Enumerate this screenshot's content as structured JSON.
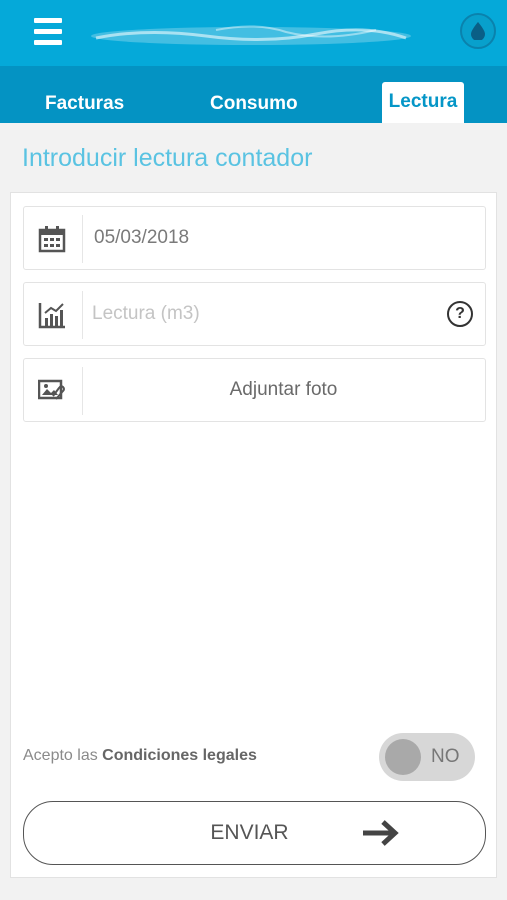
{
  "header": {
    "menu_icon": "hamburger-icon",
    "logo": "brand-logo",
    "drop_icon": "water-drop-icon"
  },
  "tabs": [
    {
      "label": "Facturas"
    },
    {
      "label": "Consumo"
    },
    {
      "label": "Lectura",
      "active": true
    }
  ],
  "page": {
    "title": "Introducir lectura contador"
  },
  "form": {
    "date_value": "05/03/2018",
    "reading_placeholder": "Lectura (m3)",
    "photo_label": "Adjuntar foto",
    "help_symbol": "?"
  },
  "legal": {
    "prefix": "Acepto las ",
    "link": "Condiciones legales",
    "toggle_label": "NO"
  },
  "send": {
    "label": "ENVIAR"
  },
  "colors": {
    "primary": "#05a9d9",
    "tabbar": "#0493c3",
    "title": "#5ac3e2"
  }
}
